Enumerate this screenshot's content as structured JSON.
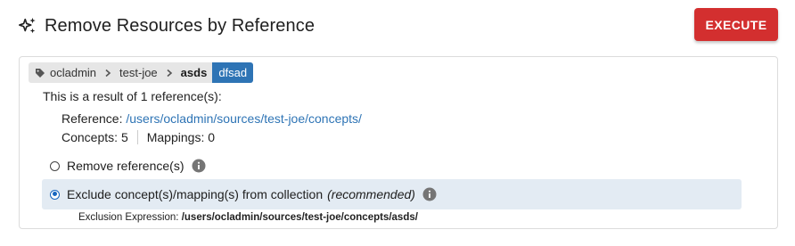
{
  "header": {
    "title": "Remove Resources by Reference",
    "execute_label": "EXECUTE"
  },
  "breadcrumb": {
    "owner": "ocladmin",
    "source": "test-joe",
    "collection": "asds",
    "version": "dfsad"
  },
  "result": {
    "summary": "This is a result of 1 reference(s):",
    "reference_label": "Reference:",
    "reference_value": "/users/ocladmin/sources/test-joe/concepts/",
    "concepts_label": "Concepts:",
    "concepts_count": "5",
    "mappings_label": "Mappings:",
    "mappings_count": "0"
  },
  "options": {
    "remove_label": "Remove reference(s)",
    "exclude_label": "Exclude concept(s)/mapping(s) from collection",
    "exclude_recommended": "(recommended)",
    "selected": "exclude"
  },
  "exclusion": {
    "label": "Exclusion Expression:",
    "value": "/users/ocladmin/sources/test-joe/concepts/asds/"
  },
  "colors": {
    "accent": "#2e74b5",
    "danger": "#d32f2f",
    "selected_bg": "#e3ebf3"
  }
}
